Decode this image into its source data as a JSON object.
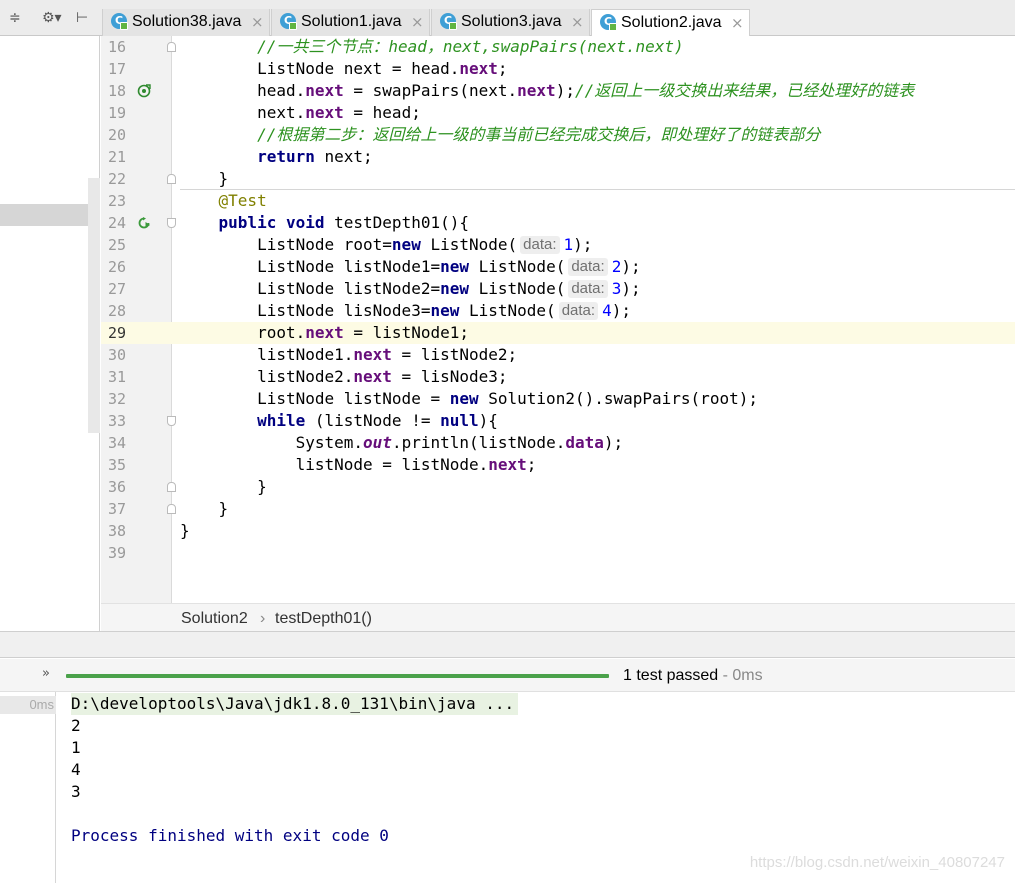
{
  "tabs": [
    {
      "label": "Solution38.java",
      "active": false
    },
    {
      "label": "Solution1.java",
      "active": false
    },
    {
      "label": "Solution3.java",
      "active": false
    },
    {
      "label": "Solution2.java",
      "active": true
    }
  ],
  "icons": {
    "tab_file": "class-file-icon",
    "tab_close": "close-icon",
    "collapse": "collapse-all-icon",
    "settings": "gear-icon",
    "hide": "hide-panel-icon",
    "breakpoint": "override-method-icon",
    "run": "run-test-icon",
    "expand": "expand-chevron-icon"
  },
  "editor": {
    "lines": [
      {
        "num": "16",
        "segs": [
          [
            "",
            "        "
          ],
          [
            "cmt",
            "//一共三个节点：head，next,swapPairs(next.next)"
          ]
        ]
      },
      {
        "num": "17",
        "segs": [
          [
            "",
            "        ListNode next = head."
          ],
          [
            "fld",
            "next"
          ],
          [
            "",
            ";"
          ]
        ]
      },
      {
        "num": "18",
        "segs": [
          [
            "",
            "        head."
          ],
          [
            "fld",
            "next"
          ],
          [
            "",
            " = swapPairs(next."
          ],
          [
            "fld",
            "next"
          ],
          [
            "",
            ");"
          ],
          [
            "cmt",
            "//返回上一级交换出来结果，已经处理好的链表"
          ]
        ]
      },
      {
        "num": "19",
        "segs": [
          [
            "",
            "        next."
          ],
          [
            "fld",
            "next"
          ],
          [
            "",
            " = head;"
          ]
        ]
      },
      {
        "num": "20",
        "segs": [
          [
            "",
            "        "
          ],
          [
            "cmt",
            "//根据第二步：返回给上一级的事当前已经完成交换后，即处理好了的链表部分"
          ]
        ]
      },
      {
        "num": "21",
        "segs": [
          [
            "",
            "        "
          ],
          [
            "kw",
            "return"
          ],
          [
            "",
            " next;"
          ]
        ]
      },
      {
        "num": "22",
        "segs": [
          [
            "",
            "    }"
          ]
        ]
      },
      {
        "num": "23",
        "segs": [
          [
            "",
            "    "
          ],
          [
            "ann",
            "@Test"
          ]
        ]
      },
      {
        "num": "24",
        "segs": [
          [
            "",
            "    "
          ],
          [
            "kw",
            "public void"
          ],
          [
            "",
            " testDepth01(){"
          ]
        ]
      },
      {
        "num": "25",
        "segs": [
          [
            "",
            "        ListNode root="
          ],
          [
            "kw",
            "new"
          ],
          [
            "",
            " ListNode("
          ],
          [
            "hint",
            "data:"
          ],
          [
            "num",
            "1"
          ],
          [
            "",
            ");"
          ]
        ]
      },
      {
        "num": "26",
        "segs": [
          [
            "",
            "        ListNode listNode1="
          ],
          [
            "kw",
            "new"
          ],
          [
            "",
            " ListNode("
          ],
          [
            "hint",
            "data:"
          ],
          [
            "num",
            "2"
          ],
          [
            "",
            ");"
          ]
        ]
      },
      {
        "num": "27",
        "segs": [
          [
            "",
            "        ListNode listNode2="
          ],
          [
            "kw",
            "new"
          ],
          [
            "",
            " ListNode("
          ],
          [
            "hint",
            "data:"
          ],
          [
            "num",
            "3"
          ],
          [
            "",
            ");"
          ]
        ]
      },
      {
        "num": "28",
        "segs": [
          [
            "",
            "        ListNode lisNode3="
          ],
          [
            "kw",
            "new"
          ],
          [
            "",
            " ListNode("
          ],
          [
            "hint",
            "data:"
          ],
          [
            "num",
            "4"
          ],
          [
            "",
            ");"
          ]
        ]
      },
      {
        "num": "29",
        "segs": [
          [
            "",
            "        root."
          ],
          [
            "fld",
            "next"
          ],
          [
            "",
            " = listNode1;"
          ]
        ]
      },
      {
        "num": "30",
        "segs": [
          [
            "",
            "        listNode1."
          ],
          [
            "fld",
            "next"
          ],
          [
            "",
            " = listNode2;"
          ]
        ]
      },
      {
        "num": "31",
        "segs": [
          [
            "",
            "        listNode2."
          ],
          [
            "fld",
            "next"
          ],
          [
            "",
            " = lisNode3;"
          ]
        ]
      },
      {
        "num": "32",
        "segs": [
          [
            "",
            "        ListNode listNode = "
          ],
          [
            "kw",
            "new"
          ],
          [
            "",
            " Solution2().swapPairs(root);"
          ]
        ]
      },
      {
        "num": "33",
        "segs": [
          [
            "",
            "        "
          ],
          [
            "kw",
            "while"
          ],
          [
            "",
            " (listNode != "
          ],
          [
            "kw",
            "null"
          ],
          [
            "",
            "){"
          ]
        ]
      },
      {
        "num": "34",
        "segs": [
          [
            "",
            "            System."
          ],
          [
            "sfld",
            "out"
          ],
          [
            "",
            ".println(listNode."
          ],
          [
            "fld",
            "data"
          ],
          [
            "",
            ");"
          ]
        ]
      },
      {
        "num": "35",
        "segs": [
          [
            "",
            "            listNode = listNode."
          ],
          [
            "fld",
            "next"
          ],
          [
            "",
            ";"
          ]
        ]
      },
      {
        "num": "36",
        "segs": [
          [
            "",
            "        }"
          ]
        ]
      },
      {
        "num": "37",
        "segs": [
          [
            "",
            "    }"
          ]
        ]
      },
      {
        "num": "38",
        "segs": [
          [
            "",
            "}"
          ]
        ]
      },
      {
        "num": "39",
        "segs": []
      }
    ]
  },
  "breadcrumb": {
    "class_name": "Solution2",
    "separator": "›",
    "method_name": "testDepth01()"
  },
  "run": {
    "progress_fraction": 1.0,
    "status_main": "1 test passed",
    "status_time": " - 0ms",
    "test_time": "0ms",
    "console": [
      "D:\\developtools\\Java\\jdk1.8.0_131\\bin\\java ...",
      "2",
      "1",
      "4",
      "3",
      "",
      "Process finished with exit code 0"
    ]
  },
  "watermark": "https://blog.csdn.net/weixin_40807247",
  "colors": {
    "keyword": "#000080",
    "field": "#660e7a",
    "comment": "#2d9220",
    "annotation": "#808000",
    "number": "#0000ff",
    "progress": "#4aa14a",
    "current_line": "#fdfbe4"
  }
}
